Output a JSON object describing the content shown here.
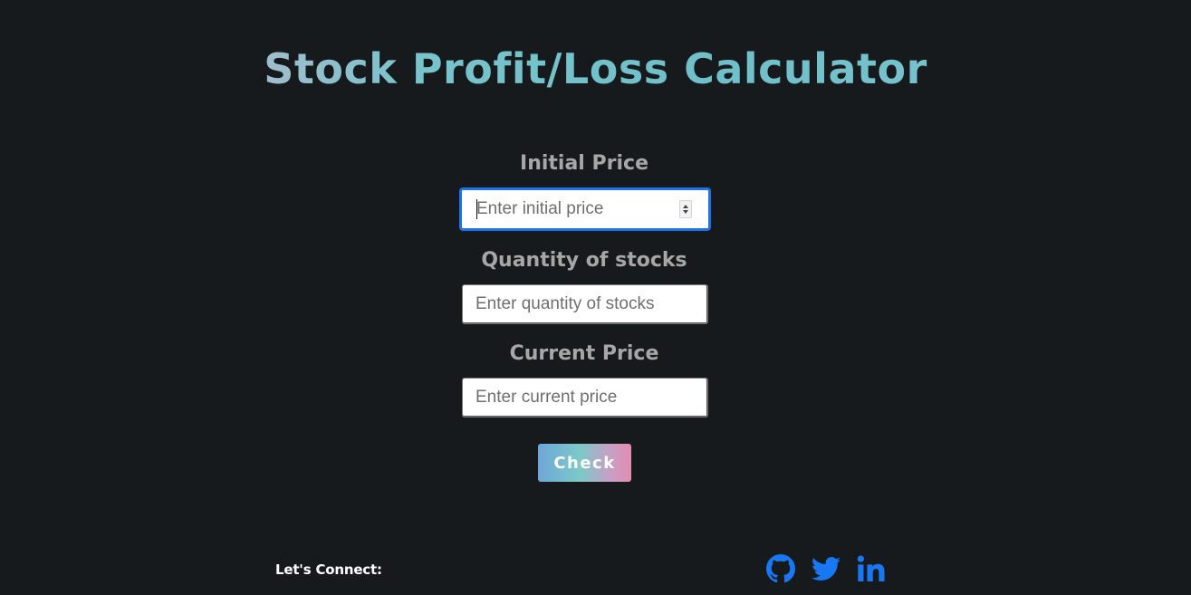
{
  "page": {
    "title": "Stock Profit/Loss Calculator"
  },
  "form": {
    "initial_price": {
      "label": "Initial Price",
      "placeholder": "Enter initial price",
      "value": ""
    },
    "quantity": {
      "label": "Quantity of stocks",
      "placeholder": "Enter quantity of stocks",
      "value": ""
    },
    "current_price": {
      "label": "Current Price",
      "placeholder": "Enter current price",
      "value": ""
    },
    "check_label": "Check"
  },
  "footer": {
    "connect_label": "Let's Connect:",
    "links": [
      {
        "icon": "github-icon"
      },
      {
        "icon": "twitter-icon"
      },
      {
        "icon": "linkedin-icon"
      }
    ]
  },
  "colors": {
    "background": "#171a1c",
    "label": "#a7a7a7",
    "focus": "#1a73e8",
    "social": "#1877f2"
  }
}
